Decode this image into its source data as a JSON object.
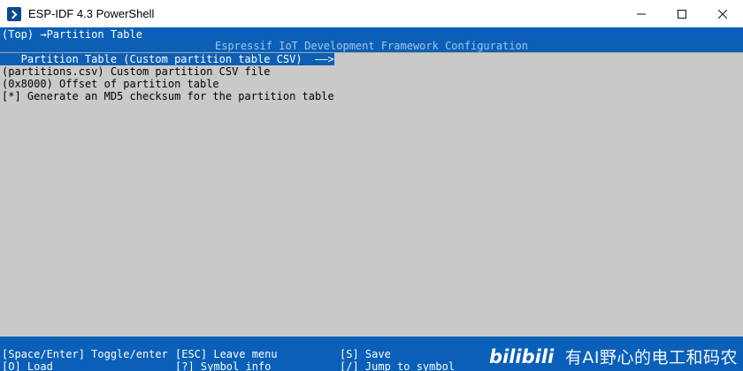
{
  "window": {
    "title": "ESP-IDF 4.3 PowerShell",
    "icon": "terminal-app-icon",
    "controls": [
      "minimize-icon",
      "maximize-icon",
      "close-icon"
    ]
  },
  "terminal": {
    "breadcrumb": "(Top) →Partition Table",
    "header": "Espressif IoT Development Framework Configuration",
    "menu_title": "   Partition Table (Custom partition table CSV)  ——>",
    "items": [
      "(partitions.csv) Custom partition CSV file",
      "(0x8000) Offset of partition table",
      "[*] Generate an MD5 checksum for the partition table"
    ],
    "footer": {
      "row1": [
        "[Space/Enter] Toggle/enter",
        "[ESC] Leave menu",
        "[S] Save"
      ],
      "row2": [
        "[O] Load",
        "[?] Symbol info",
        "[/] Jump to symbol"
      ]
    }
  },
  "watermark": {
    "logo": "bilibili",
    "text": "有AI野心的电工和码农"
  },
  "colors": {
    "terminal_bg": "#0a5fb8",
    "content_bg": "#c9c9c9",
    "titlebar_bg": "#ffffff"
  }
}
